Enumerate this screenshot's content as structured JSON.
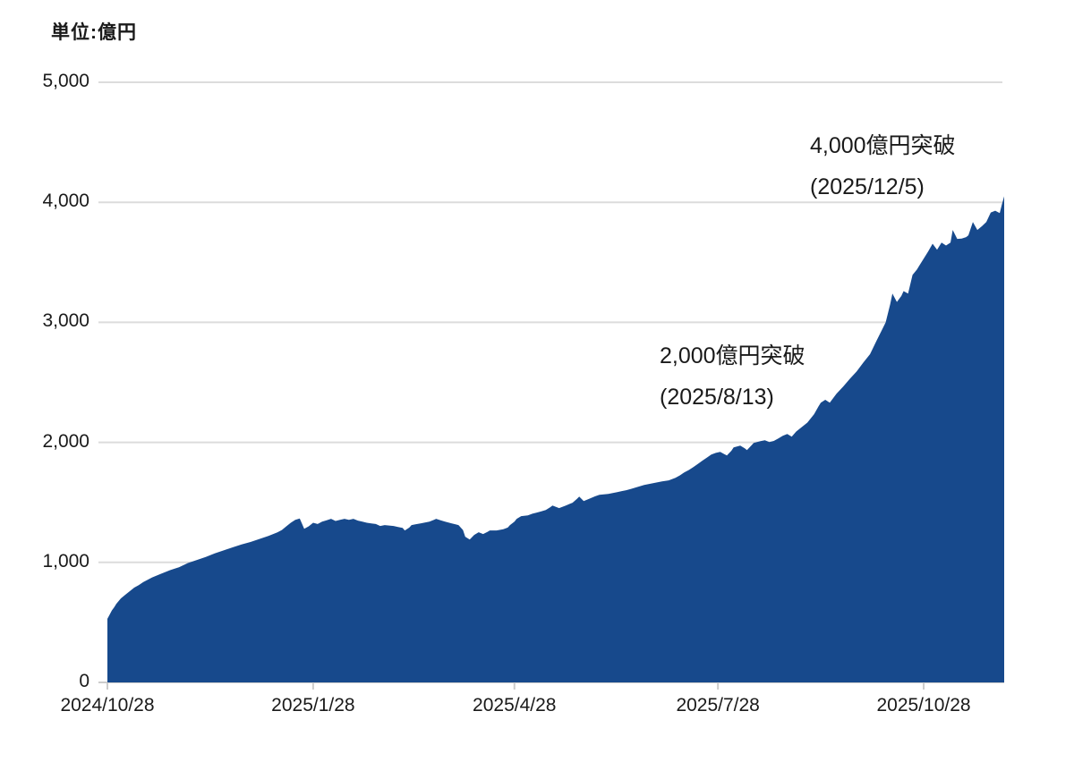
{
  "unit_label": "単位:億円",
  "annotations": {
    "a2000": {
      "line1": "2,000億円突破",
      "line2": "(2025/8/13)"
    },
    "a4000": {
      "line1": "4,000億円突破",
      "line2": "(2025/12/5)"
    }
  },
  "chart_data": {
    "type": "area",
    "title": "",
    "unit": "億円",
    "fill_color": "#17498c",
    "grid_color": "#dcdcdc",
    "axis_color": "#cccccc",
    "text_color": "#1a1a1a",
    "ylim": [
      0,
      5000
    ],
    "y_ticks": [
      0,
      1000,
      2000,
      3000,
      4000,
      5000
    ],
    "y_tick_labels": [
      "0",
      "1,000",
      "2,000",
      "3,000",
      "4,000",
      "5,000"
    ],
    "x_tick_labels": [
      "2024/10/28",
      "2025/1/28",
      "2025/4/28",
      "2025/7/28",
      "2025/10/28"
    ],
    "x_tick_days": [
      0,
      92,
      182,
      273,
      365
    ],
    "total_days": 401,
    "grid_on": true,
    "legend": "none",
    "annotations": [
      {
        "text": "2,000億円突破 (2025/8/13)",
        "value": 2000,
        "date": "2025/8/13"
      },
      {
        "text": "4,000億円突破 (2025/12/5)",
        "value": 4000,
        "date": "2025/12/5"
      }
    ],
    "points": [
      [
        0,
        530
      ],
      [
        1,
        565
      ],
      [
        2,
        600
      ],
      [
        3,
        625
      ],
      [
        4,
        655
      ],
      [
        6,
        700
      ],
      [
        8,
        730
      ],
      [
        10,
        760
      ],
      [
        12,
        790
      ],
      [
        14,
        810
      ],
      [
        16,
        835
      ],
      [
        18,
        855
      ],
      [
        20,
        875
      ],
      [
        24,
        905
      ],
      [
        28,
        935
      ],
      [
        32,
        960
      ],
      [
        36,
        995
      ],
      [
        40,
        1020
      ],
      [
        44,
        1045
      ],
      [
        48,
        1075
      ],
      [
        52,
        1100
      ],
      [
        56,
        1125
      ],
      [
        60,
        1150
      ],
      [
        64,
        1170
      ],
      [
        68,
        1195
      ],
      [
        72,
        1220
      ],
      [
        76,
        1250
      ],
      [
        78,
        1270
      ],
      [
        80,
        1300
      ],
      [
        82,
        1330
      ],
      [
        84,
        1355
      ],
      [
        86,
        1365
      ],
      [
        88,
        1280
      ],
      [
        90,
        1300
      ],
      [
        92,
        1330
      ],
      [
        94,
        1320
      ],
      [
        96,
        1340
      ],
      [
        98,
        1350
      ],
      [
        100,
        1363
      ],
      [
        102,
        1345
      ],
      [
        104,
        1355
      ],
      [
        106,
        1363
      ],
      [
        108,
        1355
      ],
      [
        110,
        1363
      ],
      [
        112,
        1348
      ],
      [
        114,
        1340
      ],
      [
        116,
        1330
      ],
      [
        118,
        1325
      ],
      [
        120,
        1320
      ],
      [
        122,
        1303
      ],
      [
        124,
        1311
      ],
      [
        126,
        1307
      ],
      [
        128,
        1303
      ],
      [
        130,
        1295
      ],
      [
        132,
        1288
      ],
      [
        133,
        1266
      ],
      [
        135,
        1290
      ],
      [
        136,
        1311
      ],
      [
        138,
        1318
      ],
      [
        140,
        1325
      ],
      [
        142,
        1332
      ],
      [
        144,
        1340
      ],
      [
        146,
        1355
      ],
      [
        147,
        1363
      ],
      [
        149,
        1350
      ],
      [
        151,
        1340
      ],
      [
        154,
        1325
      ],
      [
        157,
        1311
      ],
      [
        159,
        1270
      ],
      [
        160,
        1214
      ],
      [
        162,
        1191
      ],
      [
        164,
        1229
      ],
      [
        166,
        1251
      ],
      [
        168,
        1236
      ],
      [
        170,
        1255
      ],
      [
        171,
        1266
      ],
      [
        174,
        1266
      ],
      [
        177,
        1276
      ],
      [
        179,
        1290
      ],
      [
        180,
        1311
      ],
      [
        182,
        1340
      ],
      [
        183,
        1363
      ],
      [
        185,
        1385
      ],
      [
        188,
        1392
      ],
      [
        190,
        1405
      ],
      [
        192,
        1415
      ],
      [
        194,
        1425
      ],
      [
        196,
        1437
      ],
      [
        198,
        1460
      ],
      [
        199,
        1474
      ],
      [
        202,
        1452
      ],
      [
        205,
        1474
      ],
      [
        208,
        1497
      ],
      [
        210,
        1530
      ],
      [
        211,
        1548
      ],
      [
        213,
        1511
      ],
      [
        216,
        1534
      ],
      [
        218,
        1550
      ],
      [
        220,
        1563
      ],
      [
        222,
        1567
      ],
      [
        224,
        1571
      ],
      [
        226,
        1578
      ],
      [
        228,
        1586
      ],
      [
        230,
        1594
      ],
      [
        232,
        1601
      ],
      [
        234,
        1612
      ],
      [
        236,
        1623
      ],
      [
        238,
        1634
      ],
      [
        240,
        1645
      ],
      [
        242,
        1652
      ],
      [
        244,
        1660
      ],
      [
        246,
        1668
      ],
      [
        248,
        1675
      ],
      [
        251,
        1683
      ],
      [
        254,
        1705
      ],
      [
        256,
        1725
      ],
      [
        258,
        1750
      ],
      [
        260,
        1770
      ],
      [
        262,
        1794
      ],
      [
        264,
        1820
      ],
      [
        266,
        1847
      ],
      [
        268,
        1872
      ],
      [
        270,
        1899
      ],
      [
        272,
        1912
      ],
      [
        274,
        1921
      ],
      [
        276,
        1900
      ],
      [
        277,
        1891
      ],
      [
        279,
        1930
      ],
      [
        280,
        1958
      ],
      [
        283,
        1973
      ],
      [
        285,
        1950
      ],
      [
        286,
        1936
      ],
      [
        288,
        1975
      ],
      [
        289,
        1995
      ],
      [
        292,
        2010
      ],
      [
        294,
        2018
      ],
      [
        296,
        2003
      ],
      [
        298,
        2012
      ],
      [
        300,
        2033
      ],
      [
        302,
        2055
      ],
      [
        304,
        2070
      ],
      [
        306,
        2048
      ],
      [
        308,
        2090
      ],
      [
        310,
        2120
      ],
      [
        313,
        2165
      ],
      [
        316,
        2235
      ],
      [
        318,
        2300
      ],
      [
        319,
        2330
      ],
      [
        321,
        2355
      ],
      [
        323,
        2330
      ],
      [
        326,
        2405
      ],
      [
        329,
        2465
      ],
      [
        332,
        2530
      ],
      [
        335,
        2590
      ],
      [
        338,
        2665
      ],
      [
        341,
        2735
      ],
      [
        344,
        2850
      ],
      [
        346,
        2925
      ],
      [
        348,
        3000
      ],
      [
        350,
        3150
      ],
      [
        351,
        3240
      ],
      [
        353,
        3170
      ],
      [
        355,
        3220
      ],
      [
        356,
        3260
      ],
      [
        358,
        3240
      ],
      [
        360,
        3395
      ],
      [
        362,
        3440
      ],
      [
        363,
        3470
      ],
      [
        365,
        3530
      ],
      [
        367,
        3590
      ],
      [
        369,
        3655
      ],
      [
        371,
        3605
      ],
      [
        373,
        3665
      ],
      [
        375,
        3640
      ],
      [
        377,
        3665
      ],
      [
        378,
        3770
      ],
      [
        380,
        3695
      ],
      [
        382,
        3698
      ],
      [
        384,
        3710
      ],
      [
        385,
        3725
      ],
      [
        387,
        3835
      ],
      [
        389,
        3770
      ],
      [
        391,
        3800
      ],
      [
        393,
        3835
      ],
      [
        395,
        3915
      ],
      [
        397,
        3930
      ],
      [
        399,
        3910
      ],
      [
        400,
        3985
      ],
      [
        401,
        4050
      ]
    ]
  }
}
